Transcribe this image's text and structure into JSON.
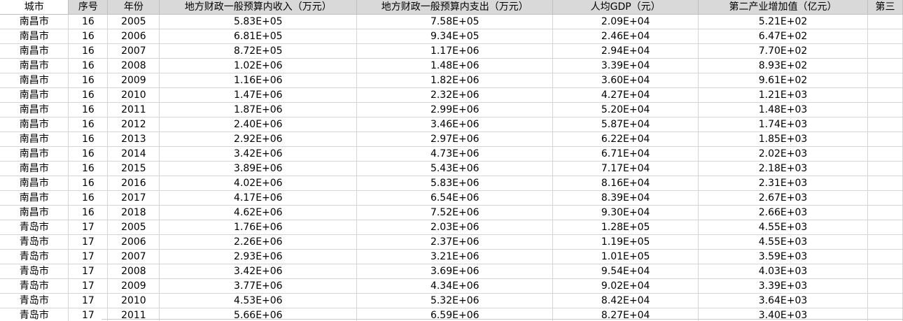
{
  "sheet": {
    "headers": [
      "城市",
      "序号",
      "年份",
      "地方财政一般预算内收入（万元）",
      "地方财政一般预算内支出（万元）",
      "人均GDP（元）",
      "第二产业增加值（亿元）",
      "第三"
    ],
    "rows": [
      [
        "南昌市",
        "16",
        "2005",
        "5.83E+05",
        "7.58E+05",
        "2.09E+04",
        "5.21E+02",
        ""
      ],
      [
        "南昌市",
        "16",
        "2006",
        "6.81E+05",
        "9.34E+05",
        "2.46E+04",
        "6.47E+02",
        ""
      ],
      [
        "南昌市",
        "16",
        "2007",
        "8.72E+05",
        "1.17E+06",
        "2.94E+04",
        "7.70E+02",
        ""
      ],
      [
        "南昌市",
        "16",
        "2008",
        "1.02E+06",
        "1.48E+06",
        "3.39E+04",
        "8.93E+02",
        ""
      ],
      [
        "南昌市",
        "16",
        "2009",
        "1.16E+06",
        "1.82E+06",
        "3.60E+04",
        "9.61E+02",
        ""
      ],
      [
        "南昌市",
        "16",
        "2010",
        "1.47E+06",
        "2.32E+06",
        "4.27E+04",
        "1.21E+03",
        ""
      ],
      [
        "南昌市",
        "16",
        "2011",
        "1.87E+06",
        "2.99E+06",
        "5.20E+04",
        "1.48E+03",
        ""
      ],
      [
        "南昌市",
        "16",
        "2012",
        "2.40E+06",
        "3.46E+06",
        "5.87E+04",
        "1.74E+03",
        ""
      ],
      [
        "南昌市",
        "16",
        "2013",
        "2.92E+06",
        "2.97E+06",
        "6.22E+04",
        "1.85E+03",
        ""
      ],
      [
        "南昌市",
        "16",
        "2014",
        "3.42E+06",
        "4.73E+06",
        "6.71E+04",
        "2.02E+03",
        ""
      ],
      [
        "南昌市",
        "16",
        "2015",
        "3.89E+06",
        "5.43E+06",
        "7.17E+04",
        "2.18E+03",
        ""
      ],
      [
        "南昌市",
        "16",
        "2016",
        "4.02E+06",
        "5.83E+06",
        "8.16E+04",
        "2.31E+03",
        ""
      ],
      [
        "南昌市",
        "16",
        "2017",
        "4.17E+06",
        "6.54E+06",
        "8.39E+04",
        "2.67E+03",
        ""
      ],
      [
        "南昌市",
        "16",
        "2018",
        "4.62E+06",
        "7.52E+06",
        "9.30E+04",
        "2.66E+03",
        ""
      ],
      [
        "青岛市",
        "17",
        "2005",
        "1.76E+06",
        "2.03E+06",
        "1.28E+05",
        "4.55E+03",
        ""
      ],
      [
        "青岛市",
        "17",
        "2006",
        "2.26E+06",
        "2.37E+06",
        "1.19E+05",
        "4.55E+03",
        ""
      ],
      [
        "青岛市",
        "17",
        "2007",
        "2.93E+06",
        "3.21E+06",
        "1.01E+05",
        "3.59E+03",
        ""
      ],
      [
        "青岛市",
        "17",
        "2008",
        "3.42E+06",
        "3.69E+06",
        "9.54E+04",
        "4.03E+03",
        ""
      ],
      [
        "青岛市",
        "17",
        "2009",
        "3.77E+06",
        "4.34E+06",
        "9.02E+04",
        "3.39E+03",
        ""
      ],
      [
        "青岛市",
        "17",
        "2010",
        "4.53E+06",
        "5.32E+06",
        "8.42E+04",
        "3.64E+03",
        ""
      ],
      [
        "青岛市",
        "17",
        "2011",
        "5.66E+06",
        "6.59E+06",
        "8.27E+04",
        "3.40E+03",
        ""
      ]
    ]
  }
}
